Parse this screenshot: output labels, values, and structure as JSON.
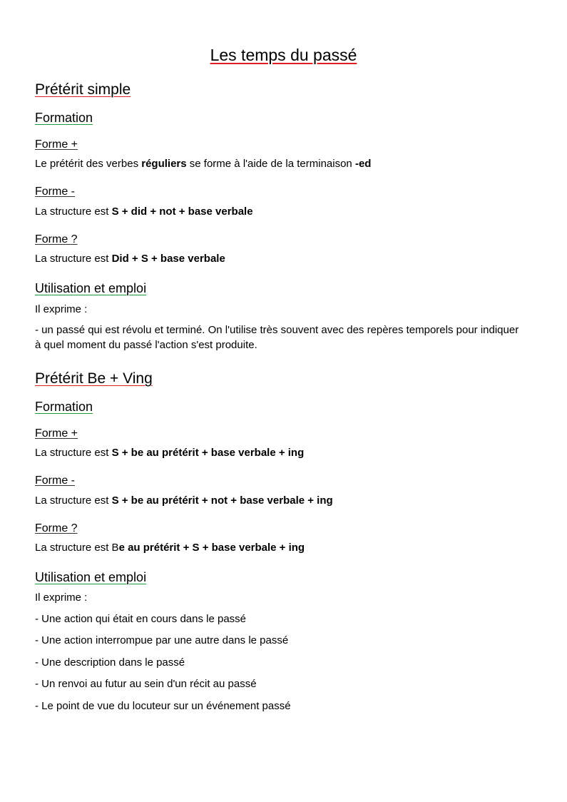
{
  "title": "Les temps du passé",
  "section1": {
    "heading": "Prétérit simple",
    "formation_heading": "Formation",
    "forme_plus": {
      "label": "Forme +",
      "text_a": "Le prétérit des verbes ",
      "bold_a": "réguliers",
      "text_b": " se forme à l'aide de la terminaison ",
      "bold_b": "-ed"
    },
    "forme_moins": {
      "label": "Forme -",
      "text_a": "La structure est ",
      "bold_a": "S + did + not + base verbale"
    },
    "forme_question": {
      "label": "Forme ?",
      "text_a": "La structure est ",
      "bold_a": "Did + S + base verbale"
    },
    "usage_heading": "Utilisation et emploi",
    "usage_intro": "Il exprime :",
    "usage_items": [
      "- un passé qui est révolu et terminé. On l'utilise très souvent avec des repères temporels pour indiquer à quel moment du passé l'action s'est produite."
    ]
  },
  "section2": {
    "heading": "Prétérit Be + Ving",
    "formation_heading": "Formation",
    "forme_plus": {
      "label": "Forme +",
      "text_a": "La structure est ",
      "bold_a": "S + be au prétérit + base verbale + ing"
    },
    "forme_moins": {
      "label": "Forme -",
      "text_a": "La structure est ",
      "bold_a": "S + be au prétérit + not + base verbale + ing"
    },
    "forme_question": {
      "label": "Forme ?",
      "text_a": "La structure est B",
      "bold_a": "e au prétérit + S + base verbale + ing"
    },
    "usage_heading": "Utilisation et emploi",
    "usage_intro": "Il exprime :",
    "usage_items": [
      "- Une action qui était en cours dans le passé",
      "- Une action interrompue par une autre dans le passé",
      "- Une description dans le passé",
      "- Un renvoi au futur au sein d'un récit au passé",
      "- Le point de vue du locuteur sur un événement passé"
    ]
  }
}
